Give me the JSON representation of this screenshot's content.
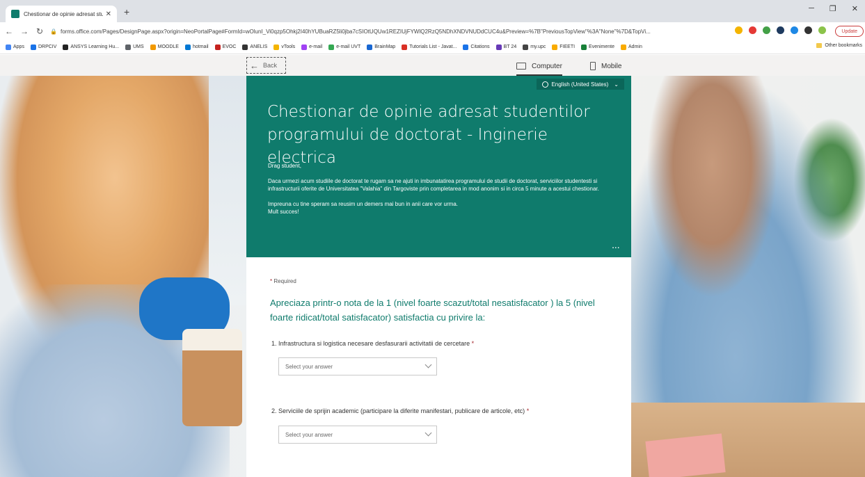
{
  "browser": {
    "tab_title": "Chestionar de opinie adresat stu...",
    "url": "forms.office.com/Pages/DesignPage.aspx?origin=NeoPortalPage#FormId=wOlunI_Vi0qzp5Ohkj2I40hYUBuaRZ5li0jba7cSIOtUQUw1REZIUjFYWlQ2RzQ5NDhXNDVNUDdCUC4u&Preview=%7B\"PreviousTopView\"%3A\"None\"%7D&TopVi...",
    "update_label": "Update",
    "bookmarks": [
      {
        "label": "Apps",
        "color": "#4285f4"
      },
      {
        "label": "DRPCIV",
        "color": "#1a73e8"
      },
      {
        "label": "ANSYS Learning Hu...",
        "color": "#222222"
      },
      {
        "label": "UMS",
        "color": "#5f6368"
      },
      {
        "label": "MOODLE",
        "color": "#f29900"
      },
      {
        "label": "hotmail",
        "color": "#0078d4"
      },
      {
        "label": "EVOC",
        "color": "#c5221f"
      },
      {
        "label": "ANELIS",
        "color": "#333333"
      },
      {
        "label": "vTools",
        "color": "#f4b400"
      },
      {
        "label": "e-mail",
        "color": "#a142f4"
      },
      {
        "label": "e-mail UVT",
        "color": "#34a853"
      },
      {
        "label": "BrainMap",
        "color": "#1967d2"
      },
      {
        "label": "Tutorials List - Javat...",
        "color": "#d93025"
      },
      {
        "label": "Citations",
        "color": "#1a73e8"
      },
      {
        "label": "BT 24",
        "color": "#673ab7"
      },
      {
        "label": "my.upc",
        "color": "#444444"
      },
      {
        "label": "FIEETI",
        "color": "#f9ab00"
      },
      {
        "label": "Evenimente",
        "color": "#188038"
      },
      {
        "label": "Admin",
        "color": "#f9ab00"
      }
    ],
    "other_bookmarks": "Other bookmarks"
  },
  "forms_bar": {
    "back_label": "Back",
    "computer_label": "Computer",
    "mobile_label": "Mobile"
  },
  "form": {
    "language": "English (United States)",
    "title": "Chestionar de opinie adresat studentilor programului de doctorat - Inginerie electrica",
    "greeting": "Drag student,",
    "paragraph1": "Daca urmezi acum studiile de doctorat te rugam sa ne ajuti in imbunatatirea programului de studii de doctorat, serviciilor studentesti si infrastructurii oferite de Universitatea \"Valahia\" din Targoviste prin completarea in mod anonim si in circa 5 minute a acestui chestionar.",
    "paragraph2": "Impreuna cu tine speram sa reusim un demers mai bun in anii care vor urma.",
    "paragraph3": "Mult succes!",
    "more_label": "...",
    "required_label": "Required",
    "section_question": "Apreciaza printr-o nota de la 1 (nivel foarte scazut/total nesatisfacator ) la 5 (nivel foarte ridicat/total satisfacator) satisfactia cu privire la:",
    "questions": [
      {
        "label": "1. Infrastructura si logistica necesare desfasurarii activitatii de cercetare",
        "placeholder": "Select your answer"
      },
      {
        "label": "2. Serviciile de sprijin academic (participare la diferite manifestari, publicare de articole, etc)",
        "placeholder": "Select your answer"
      }
    ]
  },
  "colors": {
    "theme": "#0f7b6c",
    "required_star": "#a4262c"
  }
}
